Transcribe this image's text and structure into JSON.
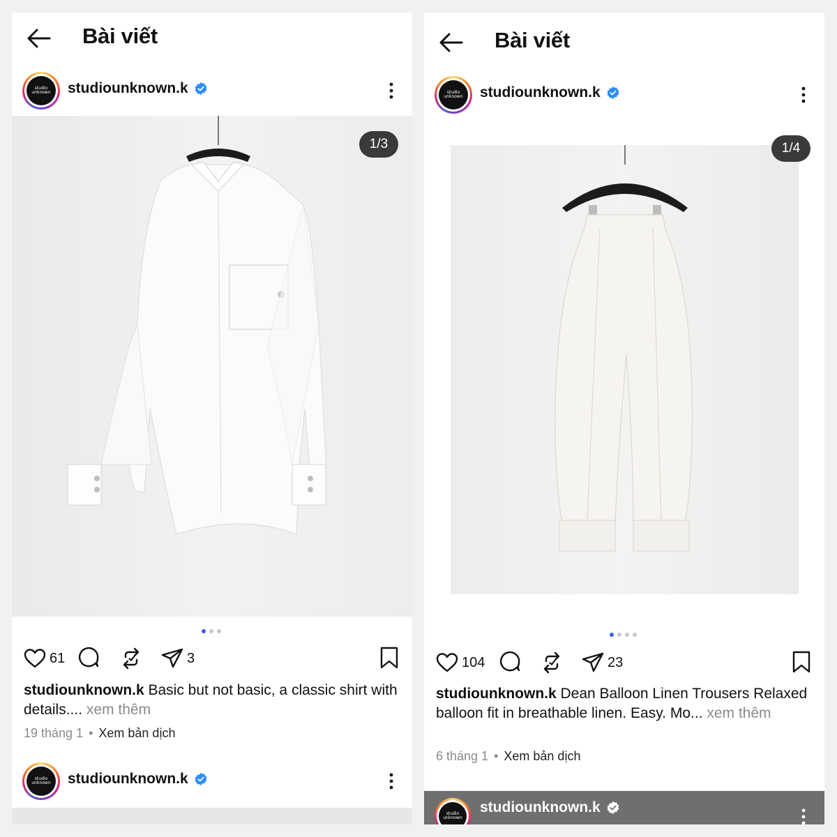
{
  "left": {
    "title": "Bài viết",
    "post": {
      "username": "studiounknown.k",
      "counter": "1/3",
      "likes": "61",
      "reposts": "",
      "shares": "3",
      "caption_user": "studiounknown.k",
      "caption_text": " Basic but not basic, a classic shirt with details.... ",
      "caption_more": "xem thêm",
      "date": "19 tháng 1",
      "separator": "•",
      "translate": "Xem bản dịch"
    },
    "next_post": {
      "username": "studiounknown.k"
    }
  },
  "right": {
    "title": "Bài viết",
    "post": {
      "username": "studiounknown.k",
      "counter": "1/4",
      "likes": "104",
      "shares": "23",
      "caption_user": "studiounknown.k",
      "caption_text": " Dean Balloon Linen Trousers Relaxed balloon fit in breathable linen. Easy. Mo... ",
      "caption_more": "xem thêm",
      "date": "6 tháng 1",
      "separator": "•",
      "translate": "Xem bản dịch"
    },
    "next_post": {
      "username": "studiounknown.k"
    }
  },
  "avatar_logo_text": "studio unknown",
  "colors": {
    "verified": "#2b8cff",
    "dot_active": "#3b5ce6",
    "text": "#111111",
    "muted": "#8a8a8a"
  },
  "icons": [
    "back-arrow-icon",
    "verified-icon",
    "more-vertical-icon",
    "heart-icon",
    "comment-icon",
    "repost-icon",
    "share-icon",
    "bookmark-icon"
  ]
}
